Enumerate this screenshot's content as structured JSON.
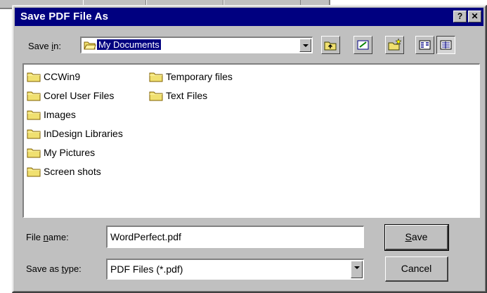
{
  "dialog": {
    "title": "Save PDF File As",
    "help_glyph": "?",
    "close_glyph": "✕"
  },
  "save_in": {
    "label_prefix": "Save ",
    "label_accel": "i",
    "label_suffix": "n:",
    "value": "My Documents",
    "icon": "folder-open-icon"
  },
  "toolbar": {
    "buttons": [
      {
        "name": "up-one-level",
        "icon": "folder-up-icon"
      },
      {
        "name": "desktop",
        "icon": "desktop-icon"
      },
      {
        "name": "create-new-folder",
        "icon": "new-folder-icon"
      },
      {
        "name": "list-view",
        "icon": "list-view-icon"
      },
      {
        "name": "details-view",
        "icon": "details-view-icon"
      }
    ]
  },
  "files": [
    {
      "name": "CCWin9"
    },
    {
      "name": "Corel User Files"
    },
    {
      "name": "Images"
    },
    {
      "name": "InDesign Libraries"
    },
    {
      "name": "My Pictures"
    },
    {
      "name": "Screen shots"
    },
    {
      "name": "Temporary files"
    },
    {
      "name": "Text Files"
    }
  ],
  "file_name": {
    "label_prefix": "File ",
    "label_accel": "n",
    "label_suffix": "ame:",
    "value": "WordPerfect.pdf"
  },
  "save_as_type": {
    "label_prefix": "Save as ",
    "label_accel": "t",
    "label_suffix": "ype:",
    "value": "PDF Files (*.pdf)"
  },
  "buttons": {
    "save_accel": "S",
    "save_rest": "ave",
    "cancel": "Cancel"
  },
  "colors": {
    "title_bar": "#000080",
    "face": "#c0c0c0",
    "folder": "#f0e070"
  }
}
